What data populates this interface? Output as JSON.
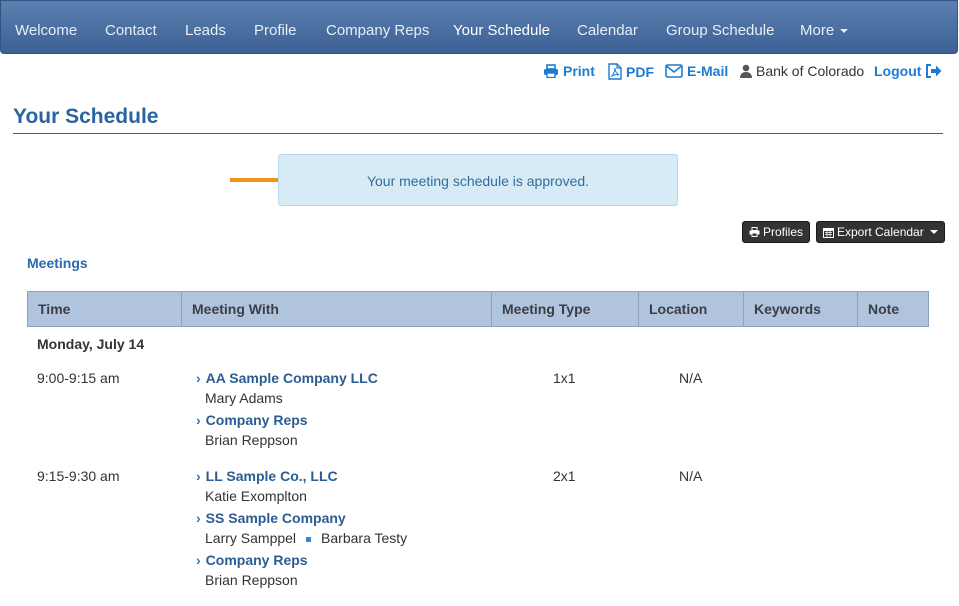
{
  "nav": {
    "items": [
      "Welcome",
      "Contact",
      "Leads",
      "Profile",
      "Company Reps",
      "Your Schedule",
      "Calendar",
      "Group Schedule",
      "More"
    ],
    "active": "Your Schedule"
  },
  "actions": {
    "print": "Print",
    "pdf": "PDF",
    "email": "E-Mail",
    "user": "Bank of Colorado",
    "logout": "Logout"
  },
  "page": {
    "title": "Your Schedule",
    "alert": "Your meeting schedule is approved."
  },
  "buttons": {
    "profiles": "Profiles",
    "export": "Export Calendar"
  },
  "meetings": {
    "section_title": "Meetings",
    "columns": [
      "Time",
      "Meeting With",
      "Meeting Type",
      "Location",
      "Keywords",
      "Note"
    ],
    "day": "Monday, July 14",
    "rows": [
      {
        "time": "9:00-9:15 am",
        "type": "1x1",
        "location": "N/A",
        "parties": [
          {
            "company": "AA Sample Company LLC",
            "people": [
              "Mary Adams"
            ]
          },
          {
            "company": "Company Reps",
            "people": [
              "Brian Reppson"
            ]
          }
        ]
      },
      {
        "time": "9:15-9:30 am",
        "type": "2x1",
        "location": "N/A",
        "parties": [
          {
            "company": "LL Sample Co., LLC",
            "people": [
              "Katie Exomplton"
            ]
          },
          {
            "company": "SS Sample Company",
            "people": [
              "Larry Samppel",
              "Barbara Testy"
            ]
          },
          {
            "company": "Company Reps",
            "people": [
              "Brian Reppson"
            ]
          }
        ]
      }
    ]
  },
  "colors": {
    "nav_top": "#5a7fb0",
    "nav_bottom": "#3d6194",
    "link": "#1f7bd1",
    "title": "#2b63a1",
    "alert_bg": "#d6ebf6",
    "header_bg": "#b0c4dd",
    "arrow": "#f0921e"
  },
  "icons": [
    "print-icon",
    "pdf-icon",
    "email-icon",
    "user-icon",
    "logout-icon",
    "printer-icon",
    "calendar-icon",
    "chevron-right-icon",
    "caret-down-icon",
    "arrow-right-icon"
  ]
}
